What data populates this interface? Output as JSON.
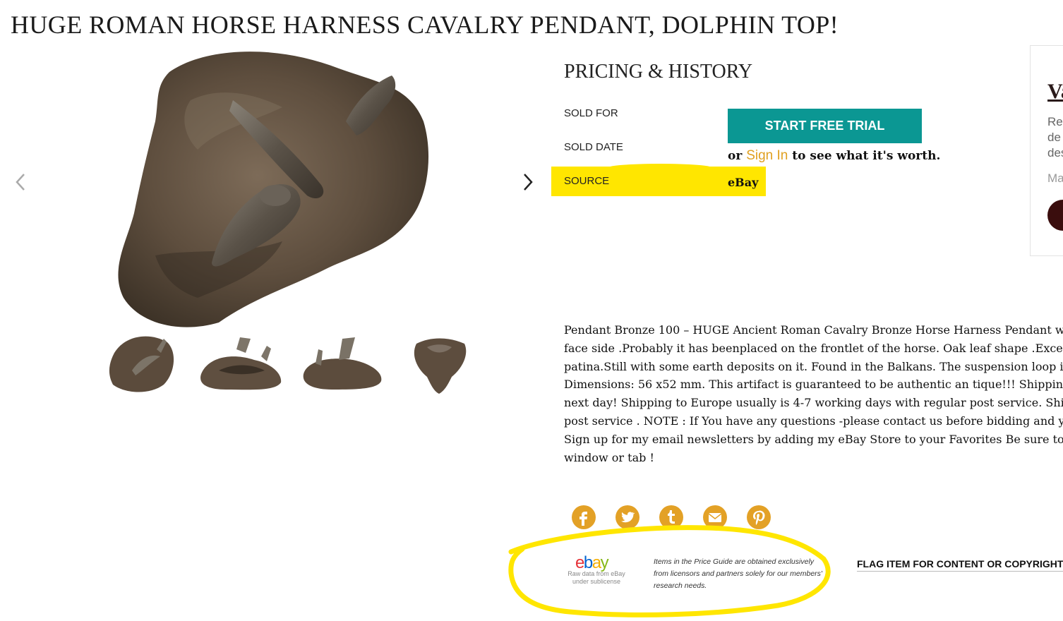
{
  "page": {
    "title": "HUGE ROMAN HORSE HARNESS CAVALRY PENDANT, DOLPHIN TOP!"
  },
  "gallery": {
    "prev_icon": "chevron-left-icon",
    "next_icon": "chevron-right-icon",
    "thumbnails": [
      "thumb-1",
      "thumb-2",
      "thumb-3",
      "thumb-4"
    ]
  },
  "pricing": {
    "heading": "PRICING & HISTORY",
    "sold_for_label": "SOLD FOR",
    "sold_date_label": "SOLD DATE",
    "source_label": "SOURCE",
    "source_value": "eBay",
    "trial_button": "START FREE TRIAL",
    "or_text": "or",
    "sign_in": "Sign In",
    "worth_text": "to see what it's worth.",
    "accent_color": "#0b9793",
    "highlight_color": "#ffe600"
  },
  "description": {
    "lines": [
      "Pendant Bronze 100 – HUGE Ancient Roman Cavalry Bronze Horse Harness Pendant with",
      "face side .Probably it has beenplaced on the frontlet of the horse. Oak leaf shape .Excepti",
      "patina.Still with some earth deposits on it. Found in the Balkans. The suspension loop is c",
      "Dimensions: 56 x52 mm. This artifact is guaranteed to be authentic an tique!!! Shipping U",
      "next day! Shipping to Europe usually is 4-7 working days with regular post service. Shipp",
      "post service . NOTE : If You have any questions -please contact us before bidding and you",
      "Sign up for my email newsletters by adding my eBay Store to your Favorites Be sure to ac",
      "window or tab !"
    ]
  },
  "social": {
    "icons": [
      "facebook-icon",
      "twitter-icon",
      "tumblr-icon",
      "email-icon",
      "pinterest-icon"
    ],
    "color": "#e3a126"
  },
  "footer": {
    "ebay_logo": "ebay",
    "ebay_sub_1": "Raw data from eBay",
    "ebay_sub_2": "under sublicense",
    "disclaimer": "Items in the Price Guide are obtained exclusively from licensors and partners solely for our members' research needs.",
    "flag_link": "FLAG ITEM FOR CONTENT OR COPYRIGHT"
  },
  "side_card": {
    "title": "Va",
    "line1": "Rec",
    "line2": "de",
    "line3": "des",
    "line4": "Ma"
  }
}
